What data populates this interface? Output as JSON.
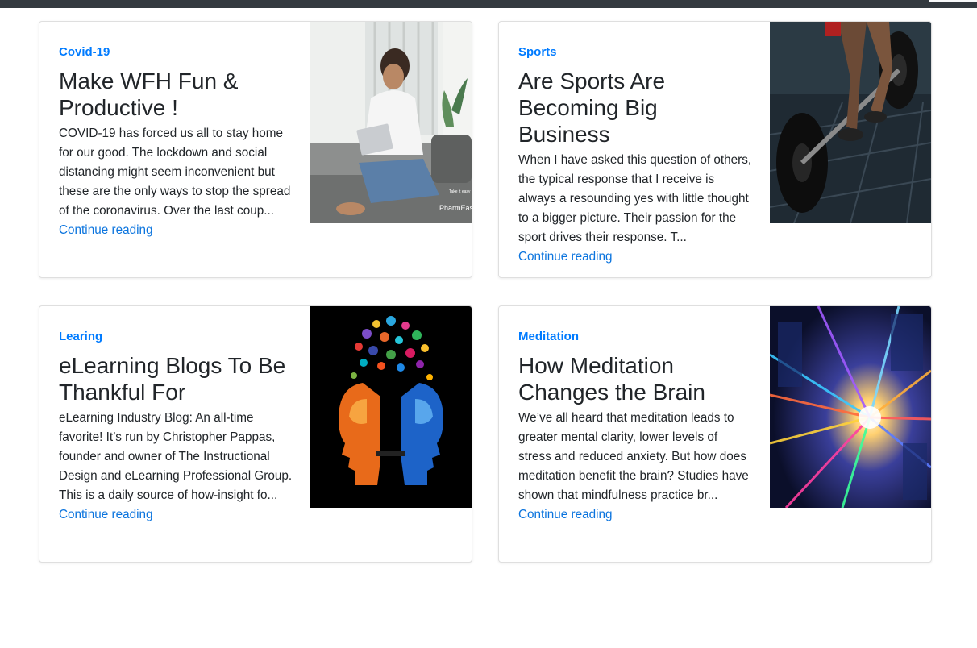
{
  "theme": {
    "accent": "#007bff",
    "link": "#0b74de",
    "text": "#212529",
    "topbar": "#343a40"
  },
  "posts": [
    {
      "category": "Covid-19",
      "title": "Make WFH Fun & Productive !",
      "excerpt": "COVID-19 has forced us all to stay home for our good. The lockdown and social distancing might seem inconvenient but these are the only ways to stop the spread of the coronavirus. Over the last coup...",
      "read_more": "Continue reading",
      "image_icon": "woman-laptop-sofa-photo",
      "image_watermark": [
        "Take it easy",
        "PharmEasy"
      ]
    },
    {
      "category": "Sports",
      "title": "Are Sports Are Becoming Big Business",
      "excerpt": "When I have asked this question of others, the typical response that I receive is always a resounding yes with little thought to a bigger picture. Their passion for the sport drives their response. T...",
      "read_more": "Continue reading",
      "image_icon": "weightlifter-barbell-photo"
    },
    {
      "category": "Learing",
      "title": "eLearning Blogs To Be Thankful For",
      "excerpt": "eLearning Industry Blog: An all-time favorite! It’s run by Christopher Pappas, founder and owner of The Instructional Design and eLearning Professional Group. This is a daily source of how-insight fo...",
      "read_more": "Continue reading",
      "image_icon": "two-heads-ideas-illustration"
    },
    {
      "category": "Meditation",
      "title": "How Meditation Changes the Brain",
      "excerpt": "We’ve all heard that meditation leads to greater mental clarity, lower levels of stress and reduced anxiety. But how does meditation benefit the brain? Studies have shown that mindfulness practice br...",
      "read_more": "Continue reading",
      "image_icon": "light-streaks-city-photo"
    }
  ]
}
